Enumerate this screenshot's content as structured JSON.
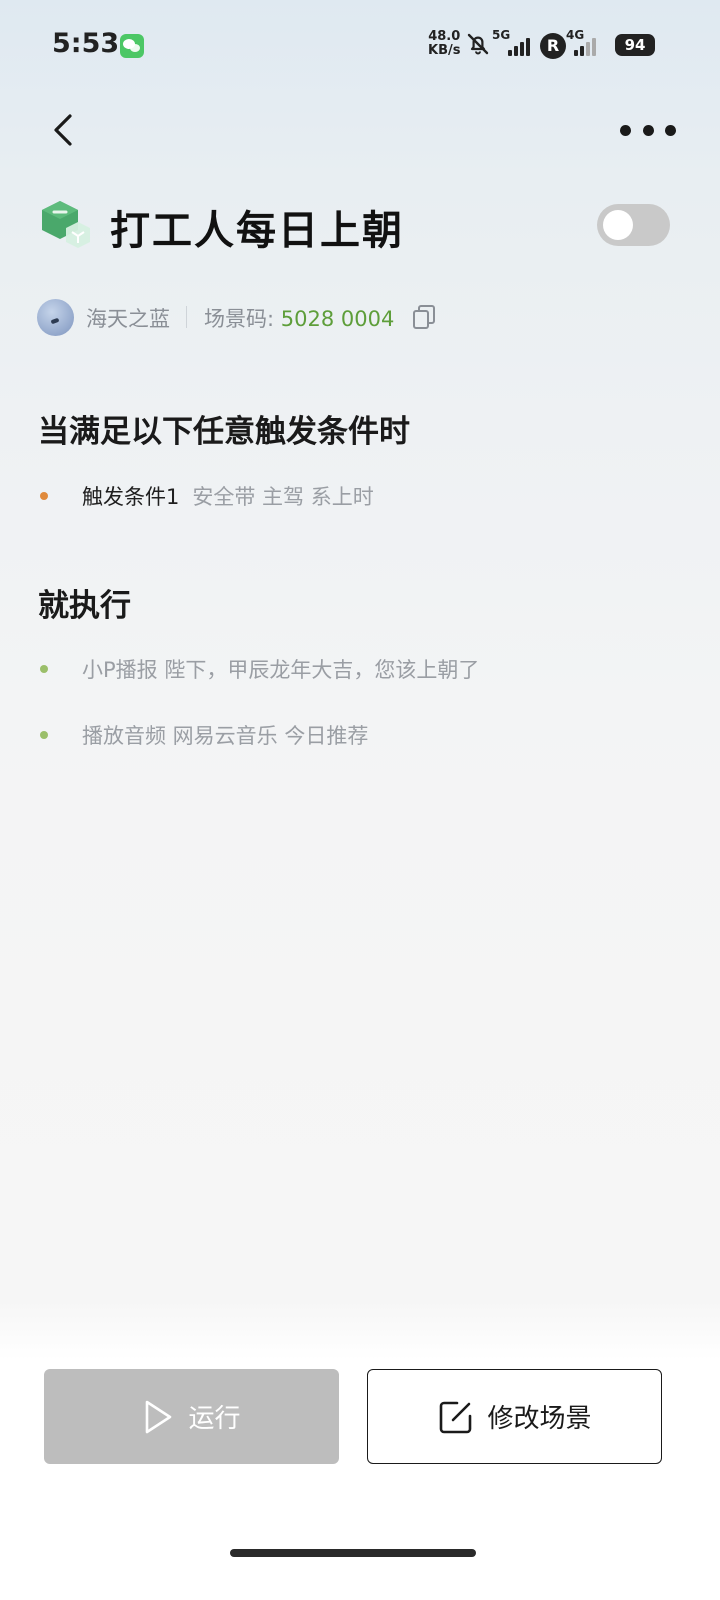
{
  "status_bar": {
    "time": "5:53",
    "net_speed_value": "48.0",
    "net_speed_unit": "KB/s",
    "sim1_type": "5G",
    "roaming_badge": "R",
    "sim2_type": "4G",
    "battery": "94",
    "icons": [
      "wechat-icon",
      "bell-off-icon",
      "signal-5g-icon",
      "signal-4g-icon",
      "battery-icon"
    ]
  },
  "nav": {
    "back_icon": "chevron-left-icon",
    "more_icon": "more-horizontal-icon"
  },
  "scene": {
    "title": "打工人每日上朝",
    "icon": "scene-cube-icon",
    "enabled": false,
    "author": "海天之蓝",
    "code_label": "场景码: ",
    "code_value": "5028 0004"
  },
  "triggers": {
    "title": "当满足以下任意触发条件时",
    "items": [
      {
        "label": "触发条件1",
        "detail": "安全带 主驾 系上时"
      }
    ]
  },
  "actions": {
    "title": "就执行",
    "items": [
      {
        "label": "",
        "detail": "小P播报 陛下，甲辰龙年大吉，您该上朝了"
      },
      {
        "label": "",
        "detail": "播放音频 网易云音乐 今日推荐"
      }
    ]
  },
  "buttons": {
    "run_label": "运行",
    "edit_label": "修改场景"
  },
  "colors": {
    "trigger_dot": "#e08a3c",
    "action_dot": "#9bbf6a",
    "code_green": "#5e9e3a",
    "run_disabled": "#bdbdbd"
  }
}
